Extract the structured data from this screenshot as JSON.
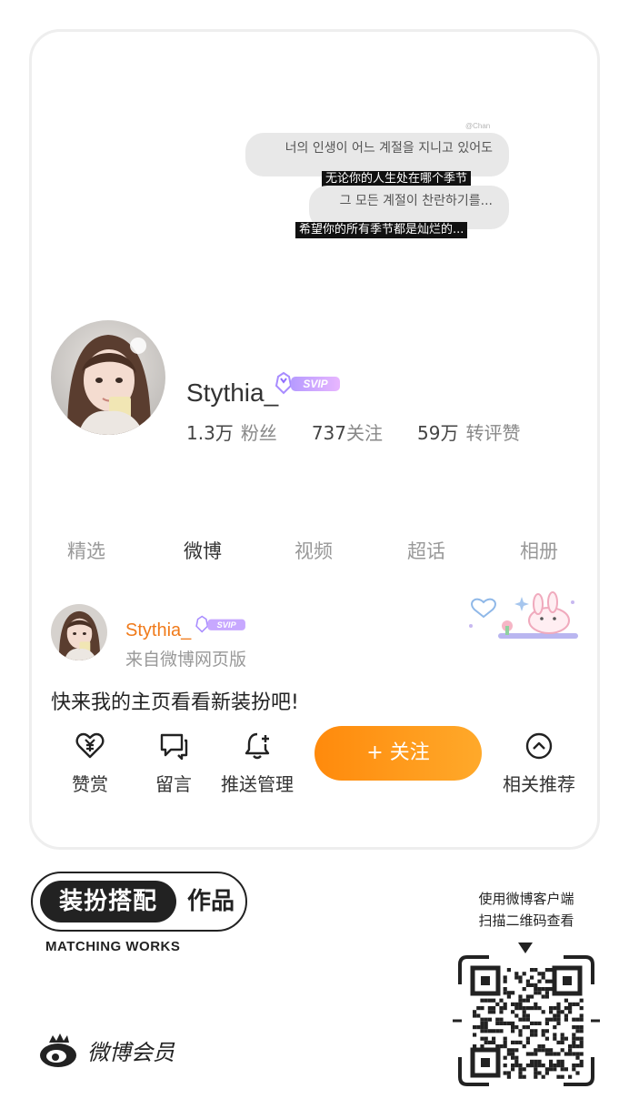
{
  "credit": "@Chan",
  "bubbles": {
    "line1_kr": "너의 인생이 어느 계절을 지니고 있어도",
    "line1_cn": "无论你的人生处在哪个季节",
    "line2_kr": "그 모든 계절이 찬란하기를...",
    "line2_cn": "希望你的所有季节都是灿烂的..."
  },
  "profile": {
    "name": "Stythia_",
    "badge": "SVIP",
    "stats": [
      {
        "value": "1.3万",
        "label": "粉丝"
      },
      {
        "value": "737",
        "label": "关注"
      },
      {
        "value": "59万",
        "label": "转评赞"
      }
    ]
  },
  "tabs": [
    {
      "label": "精选",
      "active": false
    },
    {
      "label": "微博",
      "active": true
    },
    {
      "label": "视频",
      "active": false
    },
    {
      "label": "超话",
      "active": false
    },
    {
      "label": "相册",
      "active": false
    }
  ],
  "post": {
    "author": "Stythia_",
    "badge": "SVIP",
    "source": "来自微博网页版",
    "text": "快来我的主页看看新装扮吧!"
  },
  "actions": {
    "reward": "赞赏",
    "comment": "留言",
    "push": "推送管理",
    "follow": "+ 关注",
    "related": "相关推荐"
  },
  "footer": {
    "badge_main": "装扮搭配",
    "badge_side": "作品",
    "subtitle": "MATCHING WORKS",
    "brand": "微博会员",
    "qr_line1": "使用微博客户端",
    "qr_line2": "扫描二维码查看"
  },
  "colors": {
    "accent_orange": "#ff8a0c",
    "author_orange": "#f07a1a",
    "tab_inactive": "#999999",
    "card_border": "#eeeeee"
  },
  "icons": [
    "heart-yen-icon",
    "comment-icon",
    "bell-plus-icon",
    "chevron-up-circle-icon",
    "weibo-logo-icon",
    "qr-code-icon"
  ]
}
